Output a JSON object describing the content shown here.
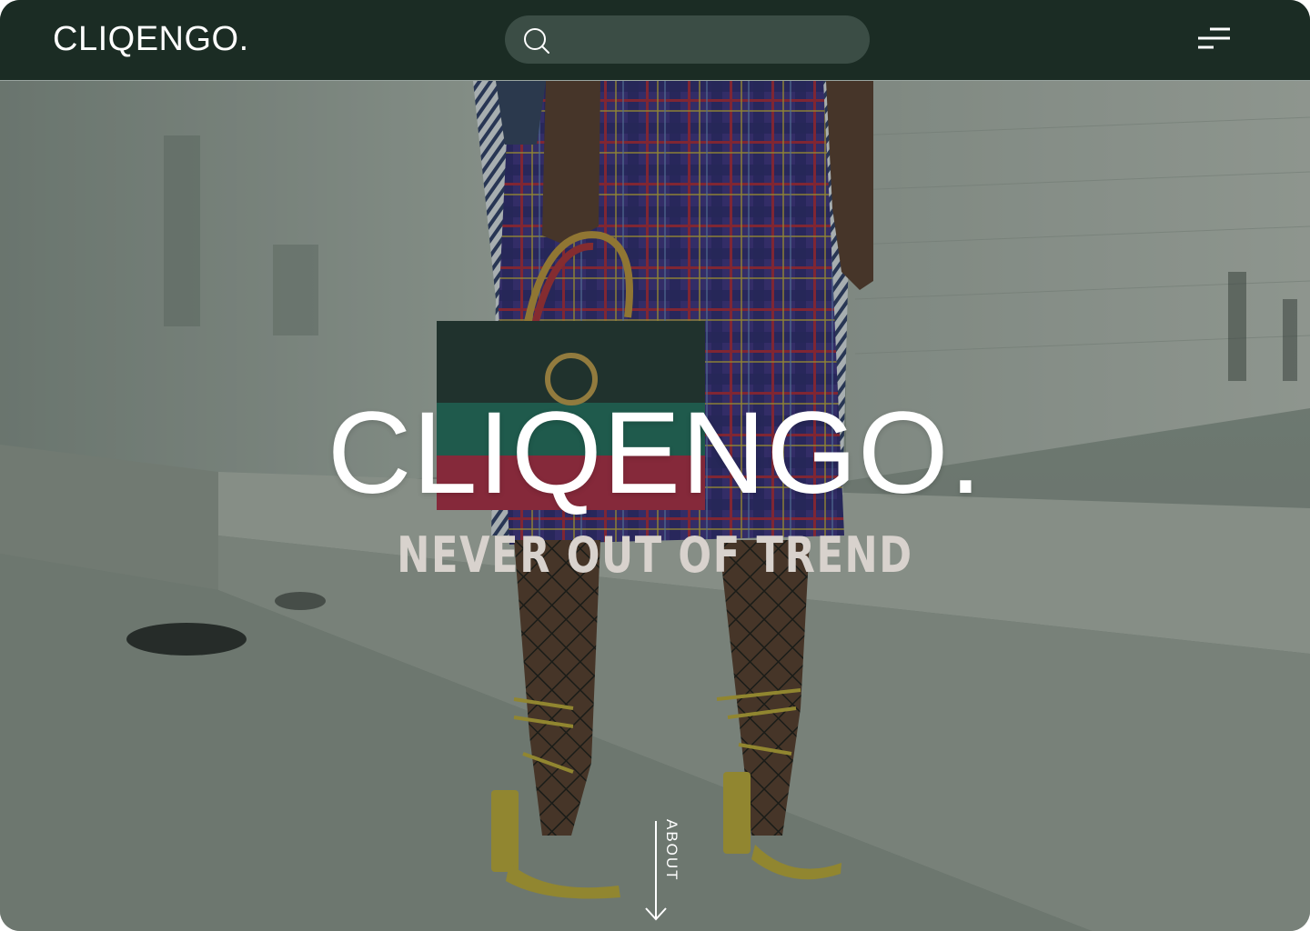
{
  "header": {
    "brand": "CLIQENGO.",
    "search": {
      "placeholder": "",
      "value": "",
      "icon": "search-icon"
    },
    "menu": {
      "icon": "menu-icon"
    }
  },
  "hero": {
    "title": "CLIQENGO.",
    "tagline": "NEVER OUT OF TREND",
    "about_label": "ABOUT",
    "about_icon": "arrow-down-icon"
  },
  "colors": {
    "header_bg": "#1b2c24",
    "search_bg": "#3b4d45",
    "text_light": "#ffffff",
    "tagline": "#d8d2cd"
  }
}
